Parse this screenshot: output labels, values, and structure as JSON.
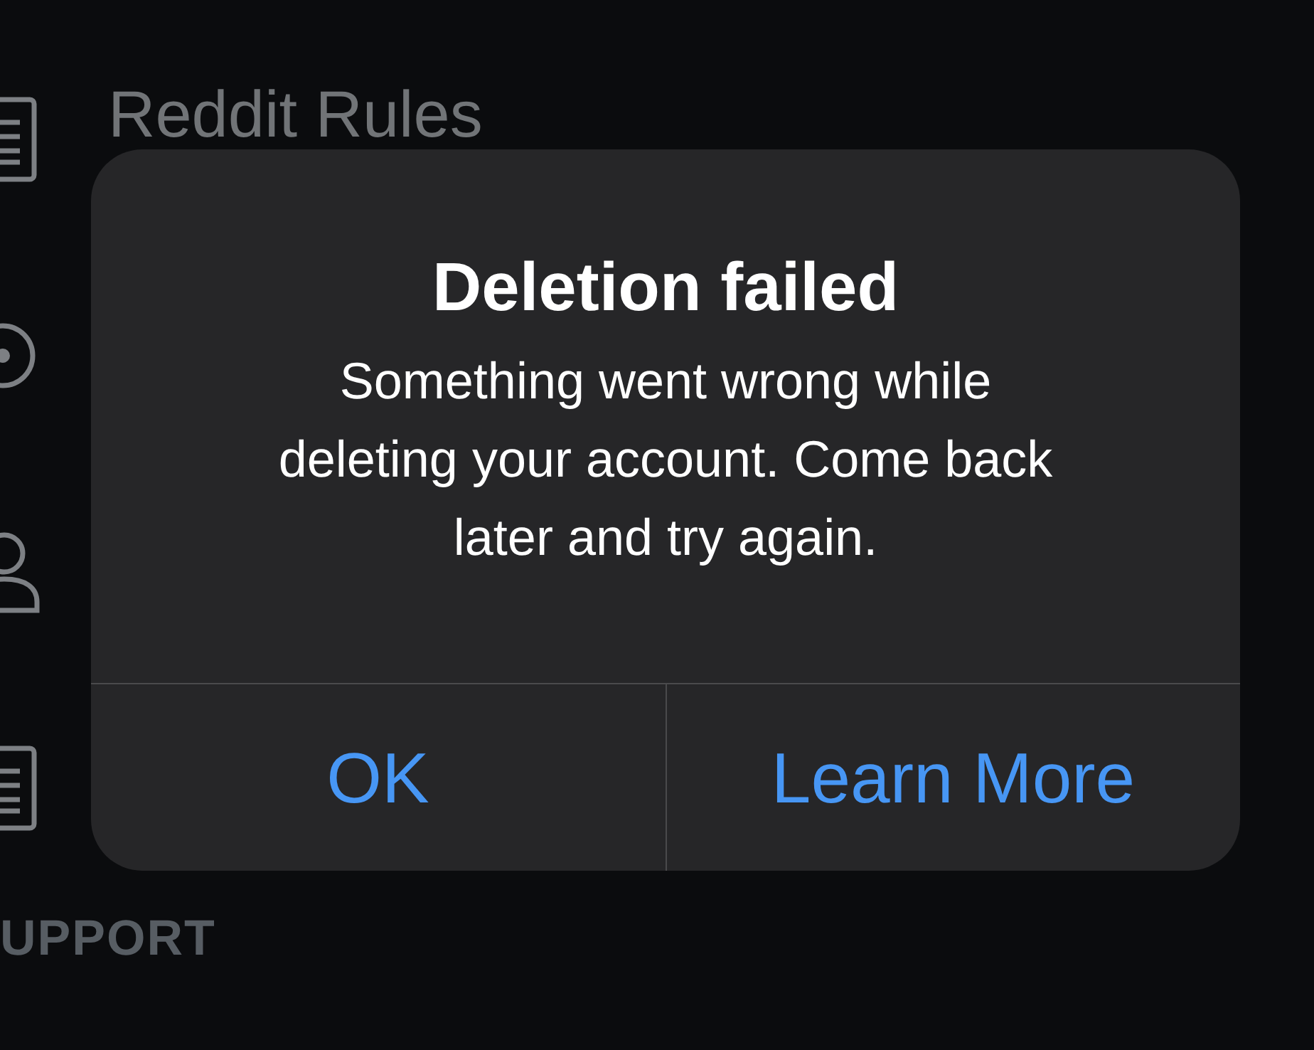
{
  "settings_list": {
    "items": [
      {
        "kind": "document",
        "label": "Reddit Rules"
      },
      {
        "kind": "target"
      },
      {
        "kind": "person"
      },
      {
        "kind": "document"
      }
    ],
    "section_header": "UPPORT"
  },
  "alert": {
    "title": "Deletion failed",
    "message": "Something went wrong while deleting your account. Come back later and try again.",
    "buttons": [
      {
        "label": "OK"
      },
      {
        "label": "Learn More"
      }
    ]
  }
}
